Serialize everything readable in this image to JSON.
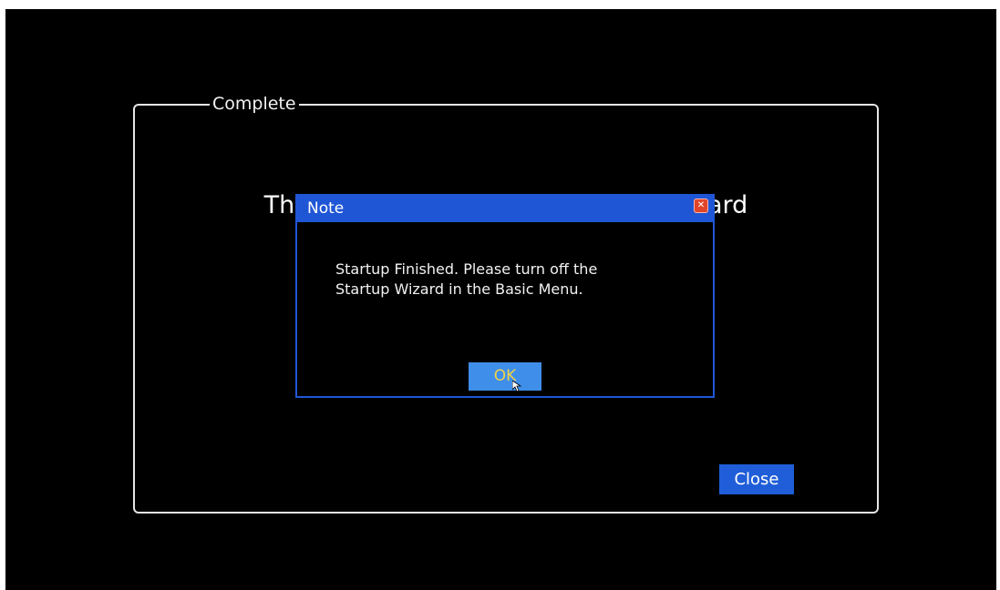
{
  "wizard": {
    "group_title": "Complete",
    "background_message": "Thank you for using the Startup Wizard",
    "close_label": "Close"
  },
  "dialog": {
    "title": "Note",
    "close_icon": "close-icon",
    "message_lines": [
      "Startup Finished. Please turn off the",
      "Startup Wizard in the Basic Menu."
    ],
    "ok_label": "OK"
  },
  "colors": {
    "background": "#000000",
    "accent_blue": "#1f56d6",
    "ok_button": "#3f8ee9",
    "ok_text": "#f0d24a",
    "close_icon": "#e0452b"
  }
}
